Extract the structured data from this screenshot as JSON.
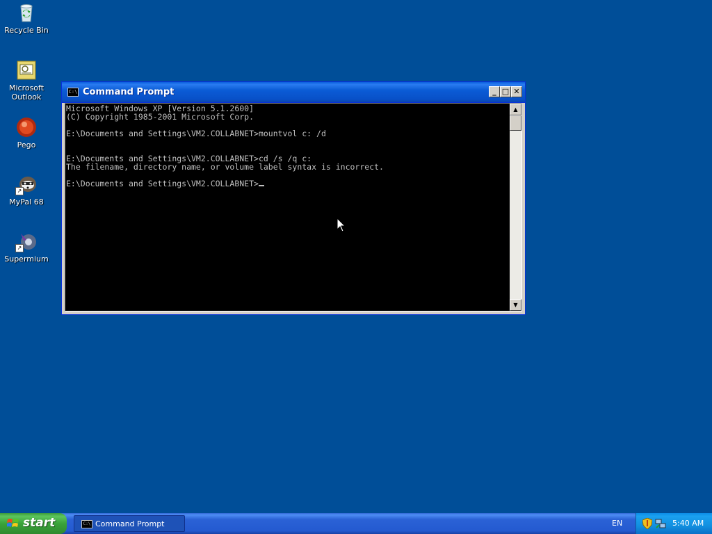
{
  "desktop": {
    "icons": [
      {
        "label": "Recycle Bin",
        "icon": "recycle-bin-icon"
      },
      {
        "label": "Microsoft Outlook",
        "icon": "outlook-icon"
      },
      {
        "label": "Pego",
        "icon": "pego-icon"
      },
      {
        "label": "MyPal 68",
        "icon": "mypal-icon"
      },
      {
        "label": "Supermium",
        "icon": "supermium-icon"
      }
    ]
  },
  "window": {
    "title": "Command Prompt",
    "icon_text": "C:\\",
    "buttons": {
      "minimize": "_",
      "maximize": "□",
      "close": "✕"
    },
    "console_lines": [
      "Microsoft Windows XP [Version 5.1.2600]",
      "(C) Copyright 1985-2001 Microsoft Corp.",
      "",
      "E:\\Documents and Settings\\VM2.COLLABNET>mountvol c: /d",
      "",
      "",
      "E:\\Documents and Settings\\VM2.COLLABNET>cd /s /q c:",
      "The filename, directory name, or volume label syntax is incorrect.",
      "",
      "E:\\Documents and Settings\\VM2.COLLABNET>"
    ]
  },
  "taskbar": {
    "start_label": "start",
    "tasks": [
      {
        "label": "Command Prompt",
        "icon_text": "C:\\"
      }
    ],
    "language": "EN",
    "clock": "5:40 AM"
  },
  "colors": {
    "desktop": "#004e98",
    "titlebar": "#0b5cd6",
    "console_bg": "#000000",
    "console_fg": "#c0c0c0",
    "start_green": "#3aa33a"
  }
}
